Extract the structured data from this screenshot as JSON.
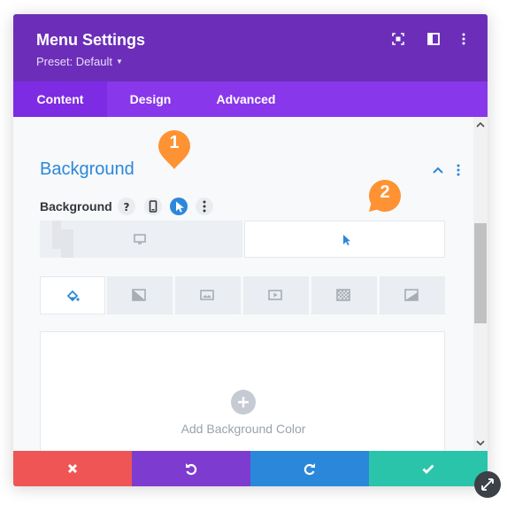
{
  "header": {
    "title": "Menu Settings",
    "preset": "Preset: Default"
  },
  "tabs": [
    {
      "label": "Content",
      "active": true
    },
    {
      "label": "Design",
      "active": false
    },
    {
      "label": "Advanced",
      "active": false
    }
  ],
  "section": {
    "title": "Background",
    "field_label": "Background"
  },
  "add_background_color": "Add Background Color",
  "callouts": {
    "one": "1",
    "two": "2"
  },
  "colors": {
    "header": "#6c2eb9",
    "tabs": "#8937eb",
    "accent_blue": "#2b87da",
    "cancel": "#ef5555",
    "undo": "#7e3bd0",
    "redo": "#2b87da",
    "save": "#29c4a9",
    "callout": "#ff9232"
  },
  "icons": {
    "header": [
      "expand-icon",
      "columns-icon",
      "kebab-icon"
    ],
    "field": [
      "help-icon",
      "mobile-icon",
      "hover-cursor-icon",
      "kebab-icon"
    ],
    "background_types": [
      "paint-bucket-icon",
      "gradient-icon",
      "image-icon",
      "video-icon",
      "pattern-icon",
      "mask-icon"
    ],
    "footer": [
      "close-icon",
      "undo-icon",
      "redo-icon",
      "check-icon"
    ]
  }
}
